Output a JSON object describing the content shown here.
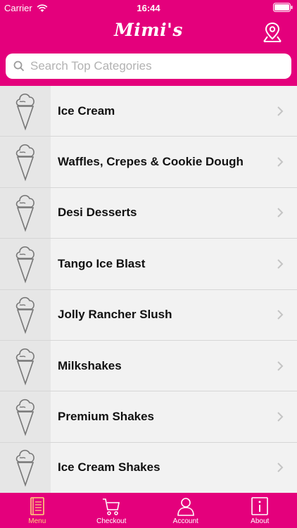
{
  "status_bar": {
    "carrier": "Carrier",
    "time": "16:44"
  },
  "header": {
    "logo": "Mimi's",
    "location_icon": "map-pin-icon"
  },
  "search": {
    "placeholder": "Search Top Categories",
    "value": ""
  },
  "categories": [
    {
      "label": "Ice Cream",
      "icon": "ice-cream-cone-icon"
    },
    {
      "label": "Waffles, Crepes & Cookie Dough",
      "icon": "ice-cream-cone-icon"
    },
    {
      "label": "Desi Desserts",
      "icon": "ice-cream-cone-icon"
    },
    {
      "label": "Tango Ice Blast",
      "icon": "ice-cream-cone-icon"
    },
    {
      "label": "Jolly Rancher Slush",
      "icon": "ice-cream-cone-icon"
    },
    {
      "label": "Milkshakes",
      "icon": "ice-cream-cone-icon"
    },
    {
      "label": "Premium Shakes",
      "icon": "ice-cream-cone-icon"
    },
    {
      "label": "Ice Cream Shakes",
      "icon": "ice-cream-cone-icon"
    }
  ],
  "tabs": [
    {
      "label": "Menu",
      "icon": "menu-book-icon",
      "active": true
    },
    {
      "label": "Checkout",
      "icon": "cart-icon",
      "active": false
    },
    {
      "label": "Account",
      "icon": "user-icon",
      "active": false
    },
    {
      "label": "About",
      "icon": "info-icon",
      "active": false
    }
  ],
  "colors": {
    "brand": "#e4007c",
    "active_tab": "#ffd27a"
  }
}
